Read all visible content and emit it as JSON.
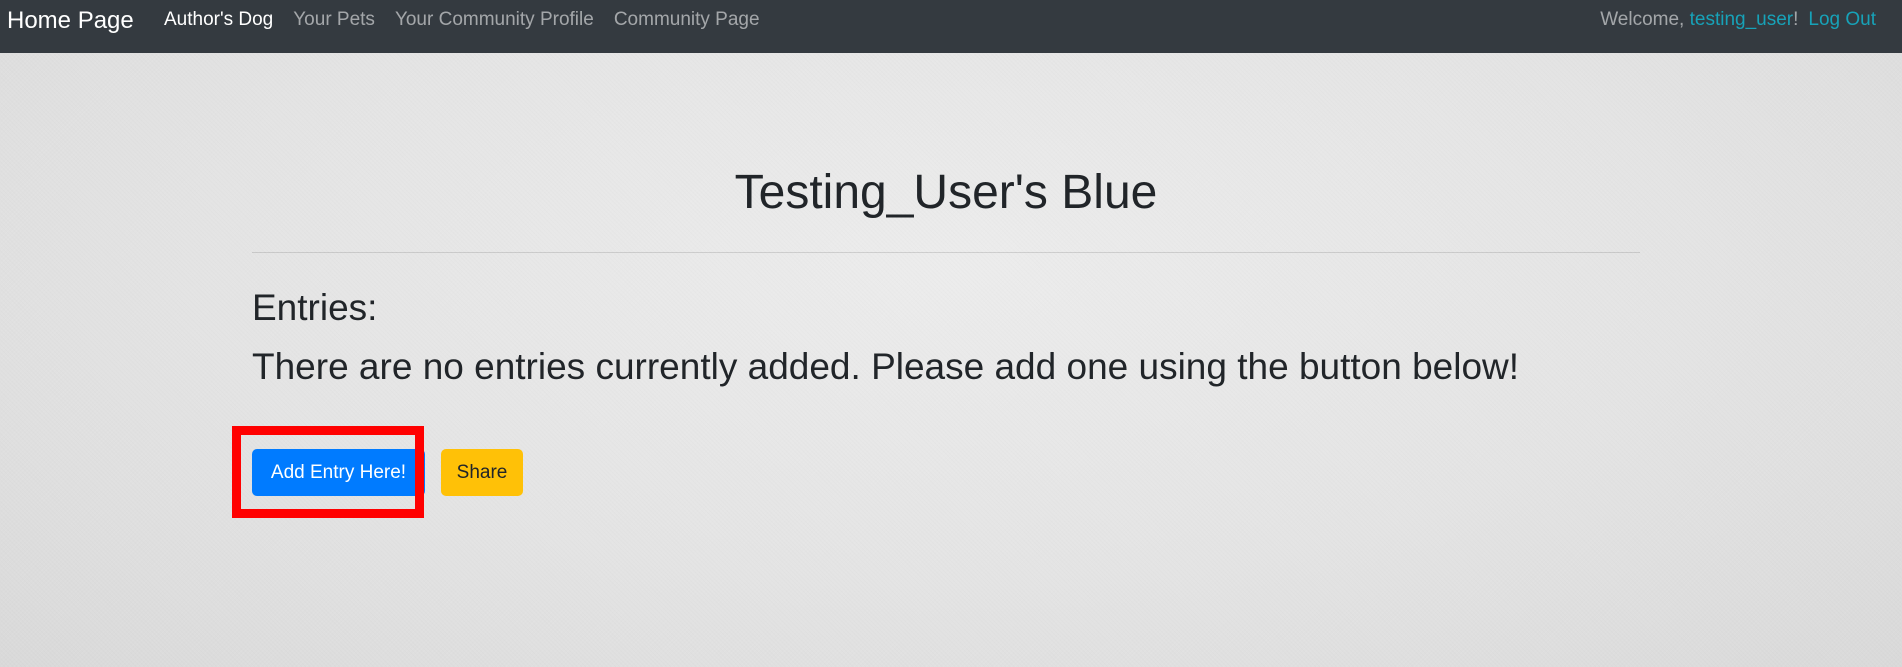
{
  "navbar": {
    "brand": "Home Page",
    "links": [
      {
        "label": "Author's Dog",
        "active": true
      },
      {
        "label": "Your Pets",
        "active": false
      },
      {
        "label": "Your Community Profile",
        "active": false
      },
      {
        "label": "Community Page",
        "active": false
      }
    ],
    "welcome_prefix": "Welcome, ",
    "username": "testing_user",
    "welcome_suffix": "!",
    "logout_label": "Log Out"
  },
  "main": {
    "title": "Testing_User's Blue",
    "entries_heading": "Entries:",
    "empty_message": "There are no entries currently added. Please add one using the button below!",
    "add_entry_label": "Add Entry Here!",
    "share_label": "Share"
  },
  "colors": {
    "navbar_bg": "#343a40",
    "primary": "#007bff",
    "warning": "#ffc107",
    "info": "#17a2b8",
    "highlight": "#ff0000"
  }
}
